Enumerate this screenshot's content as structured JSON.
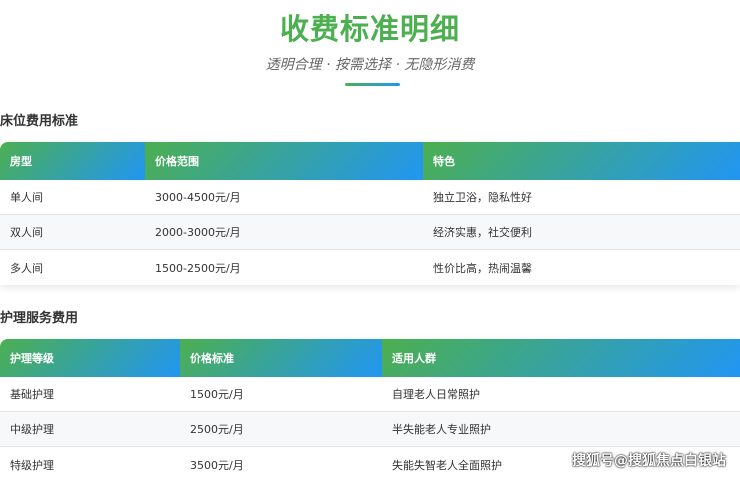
{
  "title": "收费标准明细",
  "subtitle": "透明合理 · 按需选择 · 无隐形消费",
  "bed": {
    "heading": "床位费用标准",
    "headers": [
      "房型",
      "价格范围",
      "特色"
    ],
    "rows": [
      [
        "单人间",
        "3000-4500元/月",
        "独立卫浴，隐私性好"
      ],
      [
        "双人间",
        "2000-3000元/月",
        "经济实惠，社交便利"
      ],
      [
        "多人间",
        "1500-2500元/月",
        "性价比高，热闹温馨"
      ]
    ]
  },
  "care": {
    "heading": "护理服务费用",
    "headers": [
      "护理等级",
      "价格标准",
      "适用人群"
    ],
    "rows": [
      [
        "基础护理",
        "1500元/月",
        "自理老人日常照护"
      ],
      [
        "中级护理",
        "2500元/月",
        "半失能老人专业照护"
      ],
      [
        "特级护理",
        "3500元/月",
        "失能失智老人全面照护"
      ]
    ]
  },
  "watermark": "搜狐号@搜狐焦点白银站"
}
